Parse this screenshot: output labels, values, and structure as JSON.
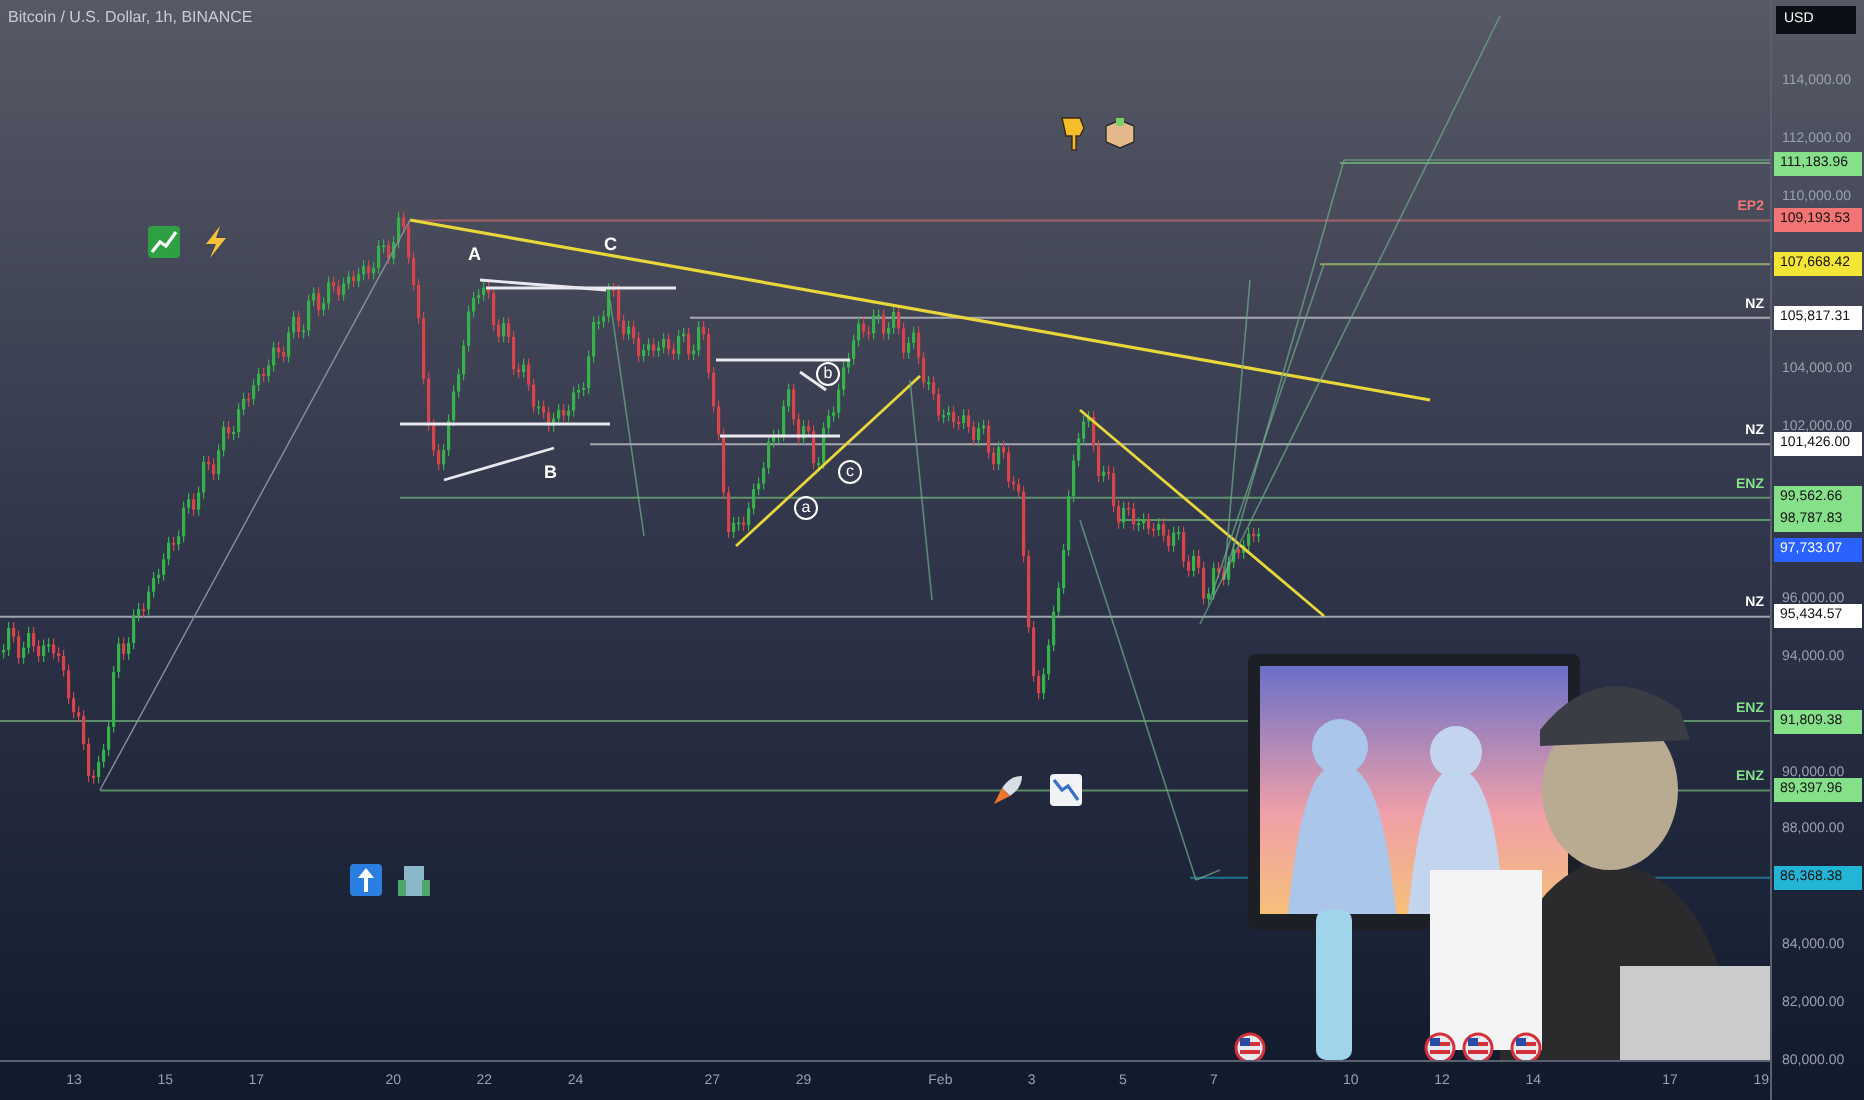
{
  "chart_title": "Bitcoin / U.S. Dollar, 1h, BINANCE",
  "currency": "USD",
  "price_ticks": [
    "114,000.00",
    "112,000.00",
    "110,000.00",
    "104,000.00",
    "102,000.00",
    "96,000.00",
    "94,000.00",
    "90,000.00",
    "88,000.00",
    "84,000.00",
    "82,000.00",
    "80,000.00"
  ],
  "levels": [
    {
      "price": "111,183.96",
      "color": "#86e08a"
    },
    {
      "price": "109,193.53",
      "color": "#f27474",
      "tag": "EP2"
    },
    {
      "price": "107,668.42",
      "color": "#f5e635"
    },
    {
      "price": "105,817.31",
      "color": "#ffffff",
      "tag": "NZ"
    },
    {
      "price": "101,426.00",
      "color": "#ffffff",
      "tag": "NZ"
    },
    {
      "price": "99,562.66",
      "color": "#86e08a",
      "tag": "ENZ"
    },
    {
      "price": "98,787.83",
      "color": "#86e08a"
    },
    {
      "price": "97,733.07",
      "color": "#2962ff"
    },
    {
      "price": "95,434.57",
      "color": "#ffffff",
      "tag": "NZ"
    },
    {
      "price": "91,809.38",
      "color": "#86e08a",
      "tag": "ENZ"
    },
    {
      "price": "89,397.96",
      "color": "#86e08a",
      "tag": "ENZ"
    },
    {
      "price": "86,368.38",
      "color": "#22b5d6"
    }
  ],
  "wave_labels": [
    {
      "text": "A",
      "kind": "plain"
    },
    {
      "text": "C",
      "kind": "plain"
    },
    {
      "text": "B",
      "kind": "plain"
    },
    {
      "text": "b",
      "kind": "circled"
    },
    {
      "text": "c",
      "kind": "circled"
    },
    {
      "text": "a",
      "kind": "circled"
    }
  ],
  "time_labels": [
    "13",
    "15",
    "17",
    "20",
    "22",
    "24",
    "27",
    "29",
    "Feb",
    "3",
    "5",
    "7",
    "10",
    "12",
    "14",
    "17",
    "19"
  ]
}
